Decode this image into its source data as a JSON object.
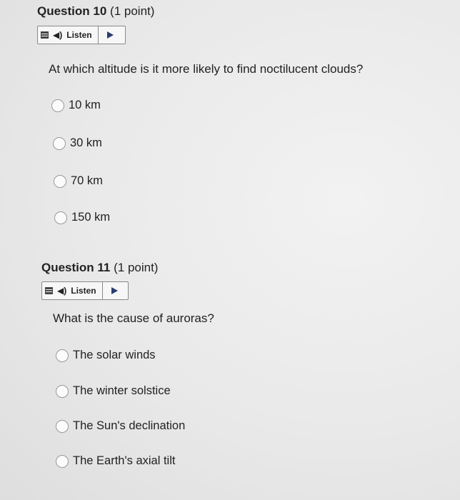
{
  "questions": [
    {
      "title": "Question 10",
      "points": "(1 point)",
      "listen_label": "Listen",
      "prompt": "At which altitude is it more likely to find noctilucent clouds?",
      "options": [
        "10 km",
        "30 km",
        "70 km",
        "150 km"
      ]
    },
    {
      "title": "Question 11",
      "points": "(1 point)",
      "listen_label": "Listen",
      "prompt": "What is the cause of auroras?",
      "options": [
        "The solar winds",
        "The winter solstice",
        "The Sun's declination",
        "The Earth's axial tilt"
      ]
    }
  ],
  "icons": {
    "menu": "menu-icon",
    "speaker": "speaker-icon",
    "play": "play-icon",
    "radio": "radio-button"
  }
}
